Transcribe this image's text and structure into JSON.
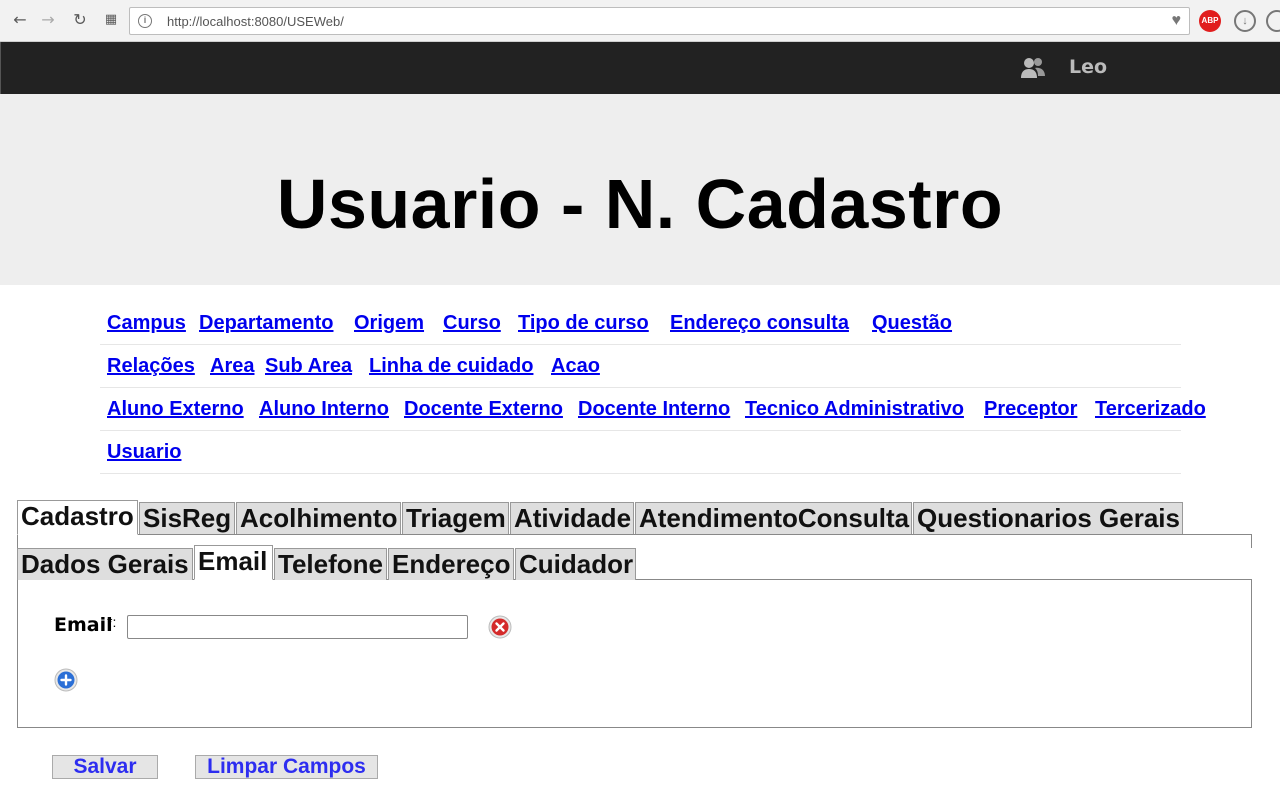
{
  "browser": {
    "url": "http://localhost:8080/USEWeb/",
    "icons": [
      "back-arrow-icon",
      "forward-arrow-icon",
      "reload-icon",
      "apps-icon",
      "info-icon",
      "heart-icon",
      "adblock-icon",
      "download-icon"
    ],
    "adblock_label": "ABP"
  },
  "header": {
    "user_name": "Leo",
    "user_icon": "users-icon"
  },
  "page": {
    "title": "Usuario - N. Cadastro"
  },
  "menu": {
    "rows": [
      [
        "Campus",
        "Departamento",
        "Origem",
        "Curso",
        "Tipo de curso",
        "Endereço consulta",
        "Questão"
      ],
      [
        "Relações",
        "Area",
        "Sub Area",
        "Linha de cuidado",
        "Acao"
      ],
      [
        "Aluno Externo",
        "Aluno Interno",
        "Docente Externo",
        "Docente Interno",
        "Tecnico Administrativo",
        "Preceptor",
        "Tercerizado"
      ],
      [
        "Usuario"
      ]
    ]
  },
  "tabs": {
    "main": [
      "Cadastro",
      "SisReg",
      "Acolhimento",
      "Triagem",
      "Atividade",
      "AtendimentoConsulta",
      "Questionarios Gerais"
    ],
    "main_active": "Cadastro",
    "sub": [
      "Dados Gerais",
      "Email",
      "Telefone",
      "Endereço",
      "Cuidador"
    ],
    "sub_active": "Email"
  },
  "form": {
    "email_label": "Email",
    "required_mark": "*:",
    "email_value": "",
    "remove_icon": "remove-circle-icon",
    "add_icon": "add-circle-icon"
  },
  "buttons": {
    "save": "Salvar",
    "clear": "Limpar Campos"
  },
  "colors": {
    "link": "#0000ee",
    "button_text": "#2d2df0",
    "topbar": "#222222",
    "hero": "#eeeeee"
  }
}
